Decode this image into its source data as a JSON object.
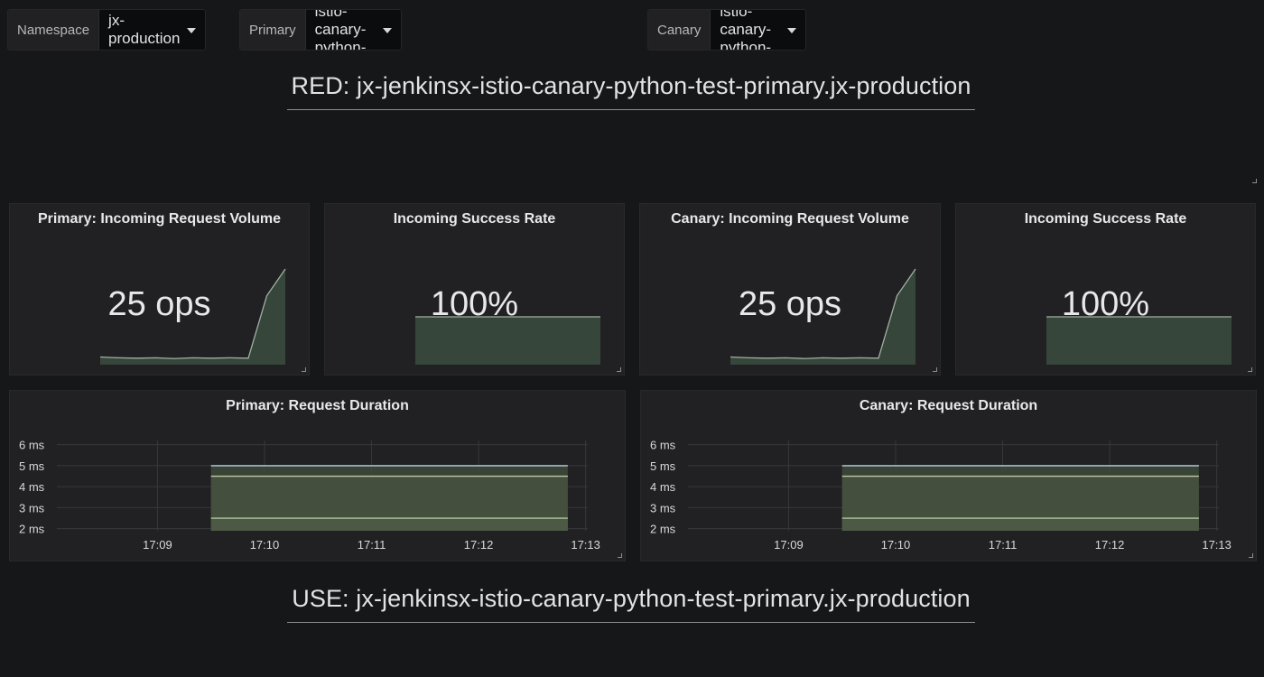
{
  "variables": [
    {
      "label": "Namespace",
      "value": "jx-production"
    },
    {
      "label": "Primary",
      "value": "jx-jenkinsx-istio-canary-python-test-primary"
    },
    {
      "label": "Canary",
      "value": "jx-jenkinsx-istio-canary-python-test-primary"
    }
  ],
  "rows": {
    "red_title": "RED: jx-jenkinsx-istio-canary-python-test-primary.jx-production",
    "use_title": "USE: jx-jenkinsx-istio-canary-python-test-primary.jx-production"
  },
  "stats": [
    {
      "title": "Primary: Incoming Request Volume",
      "value": "25 ops"
    },
    {
      "title": "Incoming Success Rate",
      "value": "100%"
    },
    {
      "title": "Canary: Incoming Request Volume",
      "value": "25 ops"
    },
    {
      "title": "Incoming Success Rate",
      "value": "100%"
    }
  ],
  "graphs": [
    {
      "title": "Primary: Request Duration"
    },
    {
      "title": "Canary: Request Duration"
    }
  ],
  "colors": {
    "background": "#161719",
    "panel": "#212124",
    "series_fill": "#3a4a3e",
    "series_line": "#9fb0a4"
  },
  "chart_data": [
    {
      "type": "area",
      "name": "primary-volume-sparkline",
      "x": [
        "17:08:15",
        "17:08:45",
        "17:09:15",
        "17:09:45",
        "17:10:15",
        "17:10:45",
        "17:11:15",
        "17:11:45",
        "17:12:15",
        "17:12:45",
        "17:13:00"
      ],
      "values": [
        2,
        1.8,
        1.7,
        1.8,
        1.6,
        1.8,
        1.7,
        1.8,
        1.7,
        18,
        25
      ],
      "ylim": [
        0,
        25
      ]
    },
    {
      "type": "area",
      "name": "primary-success-sparkline",
      "values": [
        100,
        100,
        100,
        100,
        100,
        100,
        100,
        100,
        100,
        100,
        100
      ],
      "ylim": [
        0,
        200
      ]
    },
    {
      "type": "area",
      "name": "canary-volume-sparkline",
      "values": [
        2,
        1.8,
        1.7,
        1.8,
        1.6,
        1.8,
        1.7,
        1.8,
        1.7,
        18,
        25
      ],
      "ylim": [
        0,
        25
      ]
    },
    {
      "type": "area",
      "name": "canary-success-sparkline",
      "values": [
        100,
        100,
        100,
        100,
        100,
        100,
        100,
        100,
        100,
        100,
        100
      ],
      "ylim": [
        0,
        200
      ]
    },
    {
      "type": "area",
      "name": "primary-request-duration",
      "x_ticks": [
        "17:09",
        "17:10",
        "17:11",
        "17:12",
        "17:13"
      ],
      "y_ticks": [
        "6 ms",
        "5 ms",
        "4 ms",
        "3 ms",
        "2 ms"
      ],
      "ylim": [
        1.9,
        6.2
      ],
      "x_range": [
        "17:08",
        "17:13"
      ],
      "grid": true,
      "series": [
        {
          "start": "17:09:30",
          "end": "17:12:50",
          "values": [
            5.0,
            5.0
          ]
        },
        {
          "start": "17:09:30",
          "end": "17:12:50",
          "values": [
            4.5,
            4.5
          ]
        },
        {
          "start": "17:09:30",
          "end": "17:12:50",
          "values": [
            2.5,
            2.5
          ]
        }
      ]
    },
    {
      "type": "area",
      "name": "canary-request-duration",
      "x_ticks": [
        "17:09",
        "17:10",
        "17:11",
        "17:12",
        "17:13"
      ],
      "y_ticks": [
        "6 ms",
        "5 ms",
        "4 ms",
        "3 ms",
        "2 ms"
      ],
      "ylim": [
        1.9,
        6.2
      ],
      "x_range": [
        "17:08",
        "17:13"
      ],
      "grid": true,
      "series": [
        {
          "start": "17:09:30",
          "end": "17:12:50",
          "values": [
            5.0,
            5.0
          ]
        },
        {
          "start": "17:09:30",
          "end": "17:12:50",
          "values": [
            4.5,
            4.5
          ]
        },
        {
          "start": "17:09:30",
          "end": "17:12:50",
          "values": [
            2.5,
            2.5
          ]
        }
      ]
    }
  ]
}
